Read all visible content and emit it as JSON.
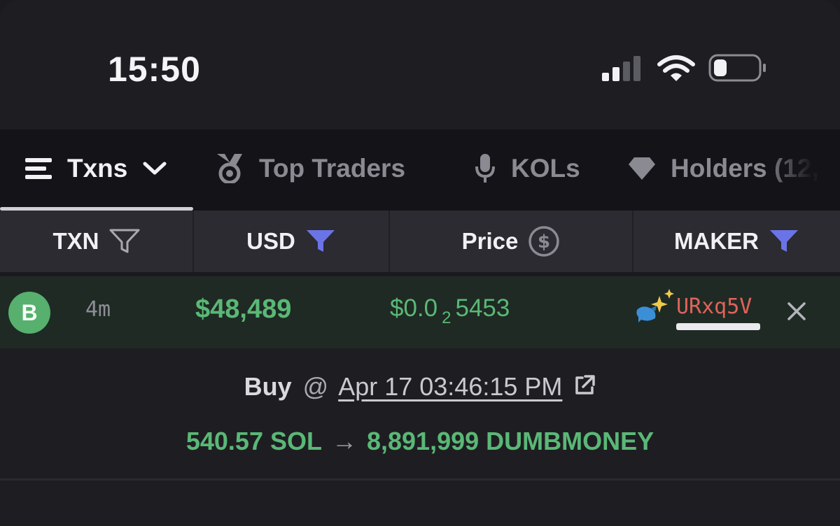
{
  "status_bar": {
    "time": "15:50",
    "icons": [
      "signal-icon",
      "wifi-icon",
      "battery-icon"
    ]
  },
  "tabs": [
    {
      "label": "Txns",
      "icon": "list-icon",
      "active": true
    },
    {
      "label": "Top Traders",
      "icon": "medal-icon",
      "active": false
    },
    {
      "label": "KOLs",
      "icon": "microphone-icon",
      "active": false
    },
    {
      "label": "Holders (12,",
      "icon": "diamond-icon",
      "active": false
    }
  ],
  "columns": {
    "txn": "TXN",
    "usd": "USD",
    "price": "Price",
    "maker": "MAKER"
  },
  "trade": {
    "badge": "B",
    "age": "4m",
    "usd": "$48,489",
    "price_prefix": "$0.0",
    "price_zeros": "2",
    "price_digits": "5453",
    "maker": "URxq5V"
  },
  "details": {
    "side": "Buy",
    "at": "@",
    "timestamp": "Apr 17 03:46:15 PM",
    "sol_amount": "540.57 SOL",
    "arrow": "→",
    "token_amount": "8,891,999 DUMBMONEY"
  },
  "colors": {
    "accent_green": "#5ab876",
    "filter_active": "#6b74e6",
    "maker_red": "#e0635a"
  }
}
